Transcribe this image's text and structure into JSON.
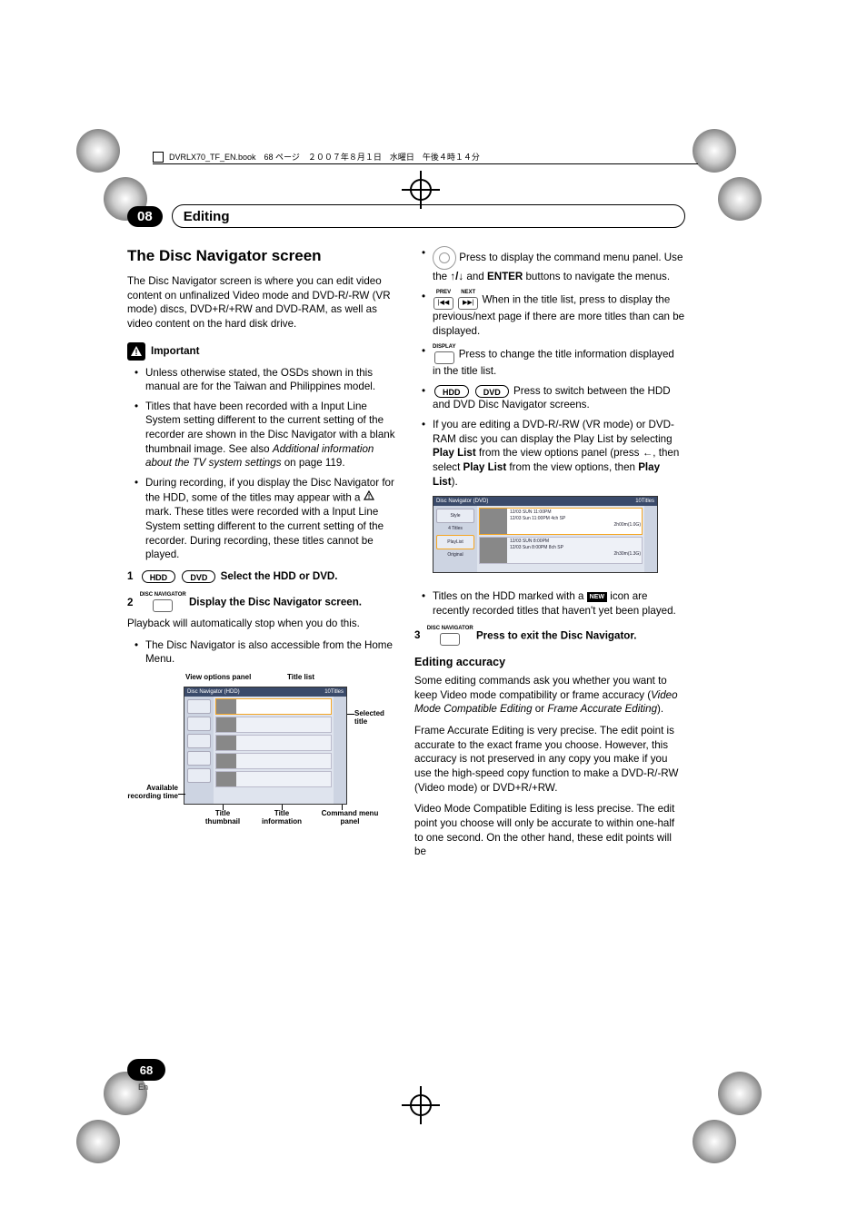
{
  "chapter": "08",
  "section": "Editing",
  "file_header": "DVRLX70_TF_EN.book　68 ページ　２００７年８月１日　水曜日　午後４時１４分",
  "page_number": "68",
  "lang": "En",
  "left": {
    "h2": "The Disc Navigator screen",
    "p1": "The Disc Navigator screen is where you can edit video content on unfinalized Video mode and DVD-R/-RW (VR mode) discs, DVD+R/+RW and DVD-RAM, as well as video content on the hard disk drive.",
    "important_label": "Important",
    "bullets": [
      "Unless otherwise stated, the OSDs shown in this manual are for the Taiwan and Philippines model.",
      "Titles that have been recorded with a Input Line System setting different to the current setting of the recorder are shown in the Disc Navigator with a blank thumbnail image. See also Additional information about the TV system settings on page 119.",
      "During recording, if you display the Disc Navigator for the HDD, some of the titles may appear with a ⚠ mark. These titles were recorded with a Input Line System setting different to the current setting of the recorder. During recording, these titles cannot be played."
    ],
    "bullet2_italic": "Additional information about the TV system settings",
    "step1_num": "1",
    "step1_hdd": "HDD",
    "step1_dvd": "DVD",
    "step1_text": "Select the HDD or DVD.",
    "step2_num": "2",
    "step2_key": "DISC NAVIGATOR",
    "step2_text": "Display the Disc Navigator screen.",
    "step2_p": "Playback will automatically stop when you do this.",
    "step2_bullet": "The Disc Navigator is also accessible from the Home Menu.",
    "dia_labels": {
      "vop": "View options panel",
      "titlelist": "Title list",
      "selected": "Selected title",
      "avail": "Available recording time",
      "thumb": "Title thumbnail",
      "info": "Title information",
      "cmd": "Command menu panel",
      "navhead": "Disc Navigator (HDD)",
      "titlecount": "10Titles"
    }
  },
  "right": {
    "b1a": " Press to display the command menu panel. Use the ",
    "b1b": " and ",
    "b1c": "ENTER",
    "b1d": " buttons to navigate the menus.",
    "b2_prev": "PREV",
    "b2_next": "NEXT",
    "b2": " When in the title list, press to display the previous/next page if there are more titles than can be displayed.",
    "b3_key": "DISPLAY",
    "b3": " Press to change the title information displayed in the title list.",
    "b4_hdd": "HDD",
    "b4_dvd": "DVD",
    "b4": " Press to switch between the HDD and DVD Disc Navigator screens.",
    "b5a": "If you are editing a DVD-R/-RW (VR mode) or DVD-RAM disc you can display the Play List by selecting ",
    "b5_pl": "Play List",
    "b5b": " from the view options panel (press ",
    "b5c": ", then select ",
    "b5d": " from the view options, then ",
    "b5e": ").",
    "dia2": {
      "navhead": "Disc Navigator (DVD)",
      "titlecount": "10Titles",
      "style": "Style",
      "four": "4 Titles",
      "playlist": "PlayList",
      "original": "Original",
      "r1a": "12/03 SUN 11:00PM",
      "r1b": "12/03 Sun 11:00PM 4ch SP",
      "r1c": "2h00m(1.0G)",
      "r2a": "12/03 SUN 8:00PM",
      "r2b": "12/03 Sun 8:00PM 8ch SP",
      "r2c": "2h30m(1.3G)"
    },
    "b6a": "Titles on the HDD marked with a ",
    "b6_new": "NEW",
    "b6b": " icon are recently recorded titles that haven't yet been played.",
    "step3_num": "3",
    "step3_key": "DISC NAVIGATOR",
    "step3_text": "Press to exit the Disc Navigator.",
    "h3": "Editing accuracy",
    "p_acc1a": "Some editing commands ask you whether you want to keep Video mode compatibility or frame accuracy (",
    "p_acc1_i": "Video Mode Compatible Editing",
    "p_acc1b": " or ",
    "p_acc1_i2": "Frame Accurate Editing",
    "p_acc1c": ").",
    "p_acc2": "Frame Accurate Editing is very precise. The edit point is accurate to the exact frame you choose. However, this accuracy is not preserved in any copy you make if you use the high-speed copy function to make a DVD-R/-RW (Video mode) or DVD+R/+RW.",
    "p_acc3": "Video Mode Compatible Editing is less precise. The edit point you choose will only be accurate to within one-half to one second. On the other hand, these edit points will be"
  }
}
